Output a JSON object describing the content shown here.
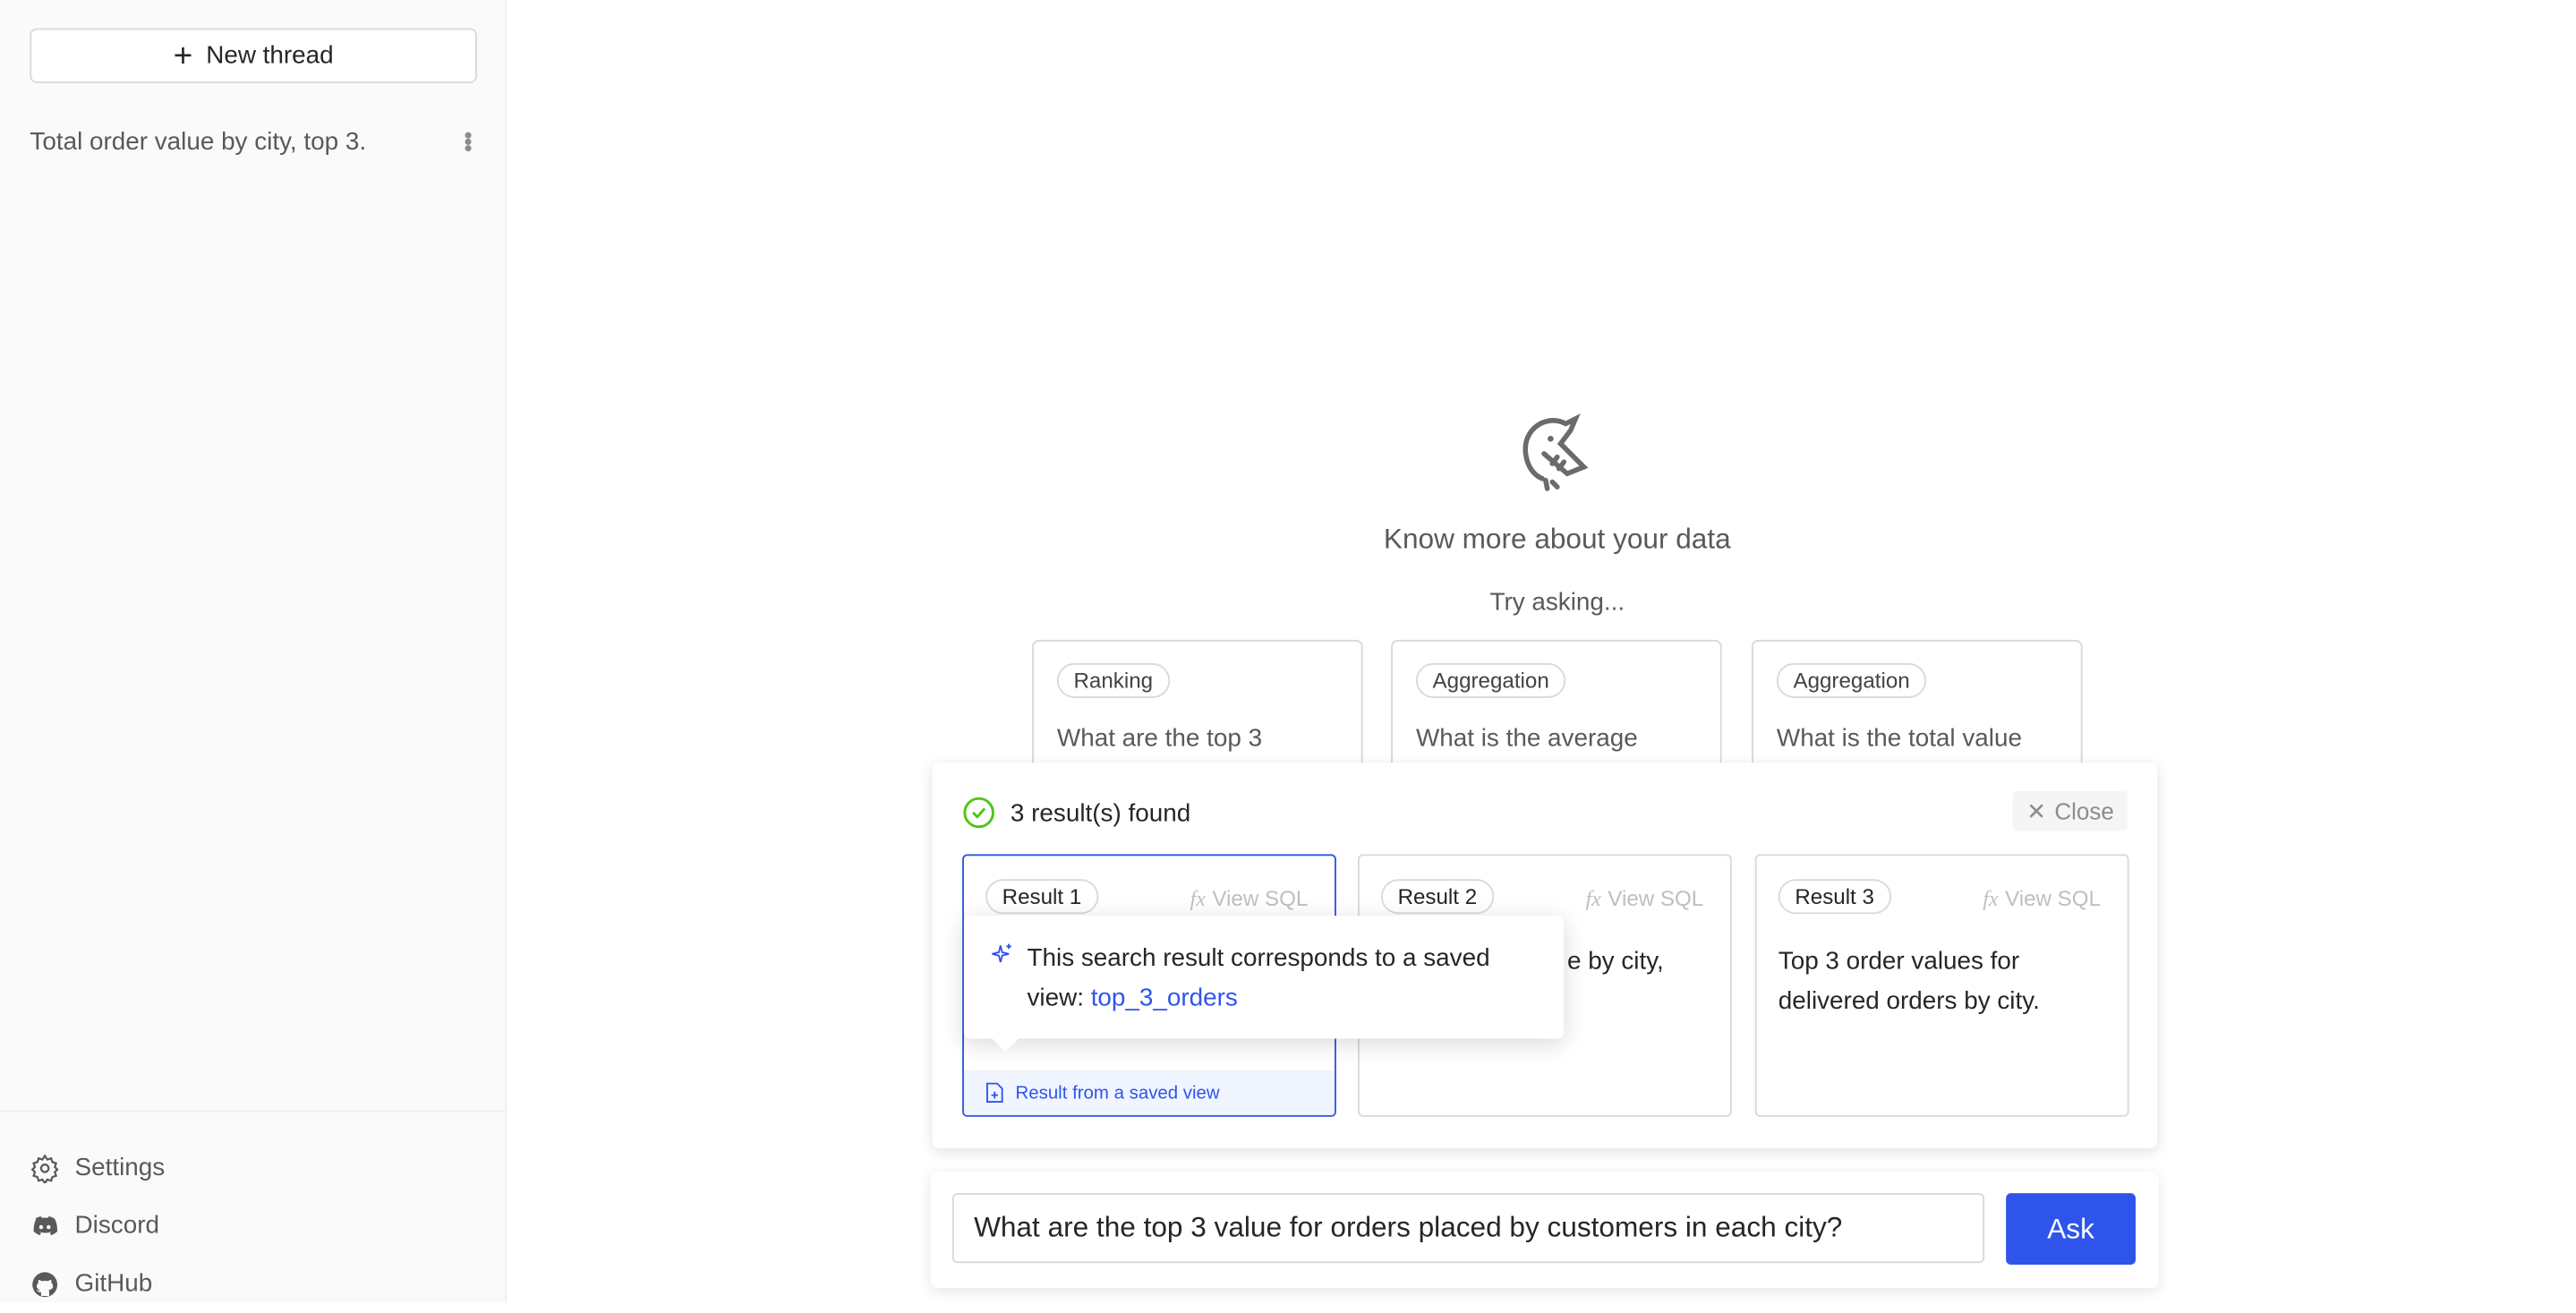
{
  "sidebar": {
    "new_thread": "New thread",
    "threads": [
      {
        "title": "Total order value by city, top 3."
      }
    ],
    "footer": [
      {
        "label": "Settings",
        "icon": "gear-icon"
      },
      {
        "label": "Discord",
        "icon": "discord-icon"
      },
      {
        "label": "GitHub",
        "icon": "github-icon"
      }
    ]
  },
  "main": {
    "title": "Know more about your data",
    "try": "Try asking...",
    "suggestions": [
      {
        "tag": "Ranking",
        "text": "What are the top 3"
      },
      {
        "tag": "Aggregation",
        "text": "What is the average"
      },
      {
        "tag": "Aggregation",
        "text": "What is the total value"
      }
    ]
  },
  "results": {
    "status": "3 result(s) found",
    "close": "Close",
    "view_sql": "View SQL",
    "items": [
      {
        "tag": "Result 1",
        "text": "",
        "footer": "Result from a saved view"
      },
      {
        "tag": "Result 2",
        "text": "e by city,"
      },
      {
        "tag": "Result 3",
        "text": "Top 3 order values for delivered orders by city."
      }
    ],
    "tooltip": {
      "text": "This search result corresponds to a saved view: ",
      "link": "top_3_orders"
    }
  },
  "ask": {
    "value": "What are the top 3 value for orders placed by customers in each city?",
    "button": "Ask"
  },
  "colors": {
    "accent": "#2f54eb",
    "success": "#52c41a"
  }
}
